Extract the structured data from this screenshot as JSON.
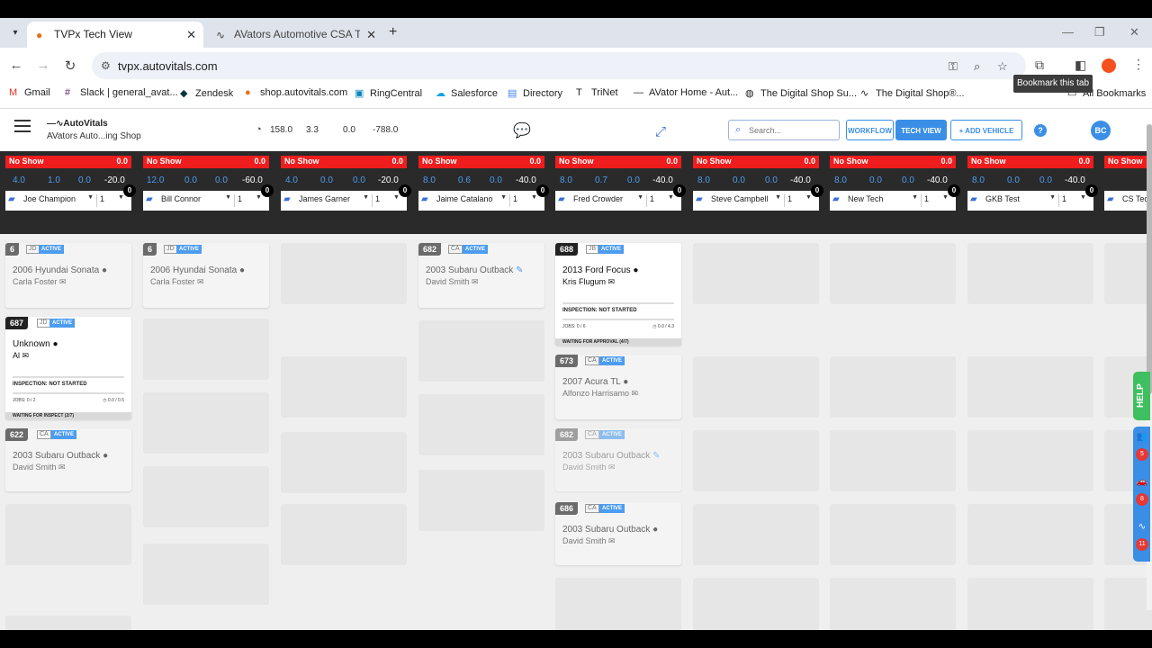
{
  "browser": {
    "tabs": [
      {
        "title": "TVPx Tech View",
        "active": true
      },
      {
        "title": "AVators Automotive CSA Traini",
        "active": false
      }
    ],
    "url": "tvpx.autovitals.com",
    "tooltip": "Bookmark this tab",
    "bookmarks": [
      "Gmail",
      "Slack | general_avat...",
      "Zendesk",
      "shop.autovitals.com",
      "RingCentral",
      "Salesforce",
      "Directory",
      "TriNet",
      "AVator Home - Aut...",
      "The Digital Shop Su...",
      "The Digital Shop®...",
      "All Bookmarks"
    ]
  },
  "app": {
    "logo": "AutoVitals",
    "shop": "AVators Auto...ing Shop",
    "stats": [
      "158.0",
      "3.3",
      "0.0",
      "-788.0"
    ],
    "search_placeholder": "Search...",
    "workflow": "WORKFLOW",
    "techview": "TECH VIEW",
    "add_vehicle": "+ ADD VEHICLE",
    "help": "?",
    "avatar": "BC"
  },
  "techs": [
    {
      "name": "Joe Champion",
      "status": "No Show",
      "status_val": "0.0",
      "nums": [
        "4.0",
        "1.0",
        "0.0",
        "-20.0"
      ],
      "count": "1",
      "badge": "0"
    },
    {
      "name": "Bill Connor",
      "status": "No Show",
      "status_val": "0.0",
      "nums": [
        "12.0",
        "0.0",
        "0.0",
        "-60.0"
      ],
      "count": "1",
      "badge": "0"
    },
    {
      "name": "James Garner",
      "status": "No Show",
      "status_val": "0.0",
      "nums": [
        "4.0",
        "0.0",
        "0.0",
        "-20.0"
      ],
      "count": "1",
      "badge": "0"
    },
    {
      "name": "Jaime Catalano",
      "status": "No Show",
      "status_val": "0.0",
      "nums": [
        "8.0",
        "0.6",
        "0.0",
        "-40.0"
      ],
      "count": "1",
      "badge": "0"
    },
    {
      "name": "Fred Crowder",
      "status": "No Show",
      "status_val": "0.0",
      "nums": [
        "8.0",
        "0.7",
        "0.0",
        "-40.0"
      ],
      "count": "1",
      "badge": "0"
    },
    {
      "name": "Steve Campbell",
      "status": "No Show",
      "status_val": "0.0",
      "nums": [
        "8.0",
        "0.0",
        "0.0",
        "-40.0"
      ],
      "count": "1",
      "badge": "0"
    },
    {
      "name": "New Tech",
      "status": "No Show",
      "status_val": "0.0",
      "nums": [
        "8.0",
        "0.0",
        "0.0",
        "-40.0"
      ],
      "count": "1",
      "badge": "0"
    },
    {
      "name": "GKB Test",
      "status": "No Show",
      "status_val": "0.0",
      "nums": [
        "8.0",
        "0.0",
        "0.0",
        "-40.0"
      ],
      "count": "1",
      "badge": "0"
    },
    {
      "name": "CS Tec",
      "status": "No Show",
      "status_val": "",
      "nums": [],
      "count": "",
      "badge": ""
    }
  ],
  "cards": {
    "c1": {
      "num": "6",
      "tag": "JD",
      "status": "ACTIVE",
      "vehicle": "2006 Hyundai Sonata",
      "customer": "Carla Foster"
    },
    "c2": {
      "num": "687",
      "tag": "JD",
      "status": "ACTIVE",
      "vehicle": "Unknown",
      "customer": "Al",
      "inspection": "INSPECTION: NOT STARTED",
      "jobs": "JOBS: 0 / 2",
      "hours": "0.0 / 0.5",
      "waiting": "WAITING FOR INSPECT (2/7)"
    },
    "c3": {
      "num": "622",
      "tag": "CA",
      "status": "ACTIVE",
      "vehicle": "2003 Subaru Outback",
      "customer": "David Smith"
    },
    "c4": {
      "num": "6",
      "tag": "JD",
      "status": "ACTIVE",
      "vehicle": "2006 Hyundai Sonata",
      "customer": "Carla Foster"
    },
    "c5": {
      "num": "682",
      "tag": "CA",
      "status": "ACTIVE",
      "vehicle": "2003 Subaru Outback",
      "customer": "David Smith"
    },
    "c6": {
      "num": "688",
      "tag": "JB",
      "status": "ACTIVE",
      "vehicle": "2013 Ford Focus",
      "customer": "Kris Flugum",
      "inspection": "INSPECTION: NOT STARTED",
      "jobs": "JOBS: 0 / 6",
      "hours": "0.0 / 4.3",
      "waiting": "WAITING FOR APPROVAL (4/7)"
    },
    "c7": {
      "num": "673",
      "tag": "CA",
      "status": "ACTIVE",
      "vehicle": "2007 Acura TL",
      "customer": "Alfonzo Harrisamo"
    },
    "c8": {
      "num": "682",
      "tag": "CA",
      "status": "ACTIVE",
      "vehicle": "2003 Subaru Outback",
      "customer": "David Smith"
    },
    "c9": {
      "num": "686",
      "tag": "CA",
      "status": "ACTIVE",
      "vehicle": "2003 Subaru Outback",
      "customer": "David Smith"
    }
  },
  "side": {
    "help": "HELP",
    "counts": [
      "5",
      "8",
      "11"
    ]
  }
}
